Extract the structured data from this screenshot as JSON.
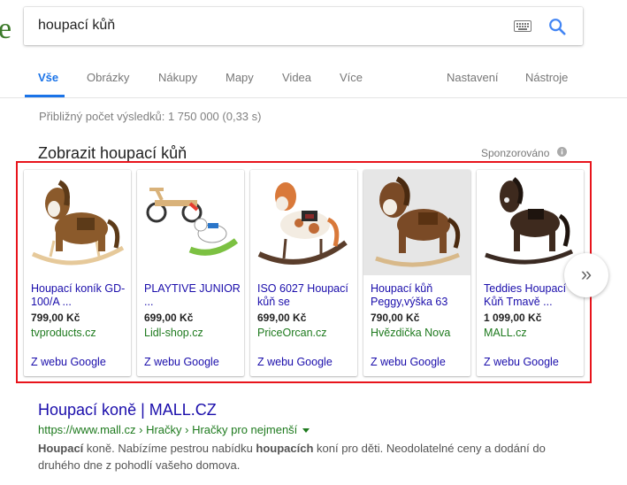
{
  "search": {
    "query": "houpací kůň"
  },
  "tabs": [
    {
      "label": "Vše",
      "active": true
    },
    {
      "label": "Obrázky"
    },
    {
      "label": "Nákupy"
    },
    {
      "label": "Mapy"
    },
    {
      "label": "Videa"
    },
    {
      "label": "Více"
    },
    {
      "label": "Nastavení"
    },
    {
      "label": "Nástroje"
    }
  ],
  "stats": "Přibližný počet výsledků: 1 750 000 (0,33 s)",
  "shopping": {
    "title": "Zobrazit houpací kůň",
    "sponsored": "Sponzorováno",
    "cards": [
      {
        "title": "Houpací koník GD-100/A ...",
        "price": "799,00 Kč",
        "store": "tvproducts.cz",
        "link": "Z webu Google"
      },
      {
        "title": "PLAYTIVE JUNIOR ...",
        "price": "699,00 Kč",
        "store": "Lidl-shop.cz",
        "link": "Z webu Google"
      },
      {
        "title": "ISO 6027 Houpací kůň se",
        "price": "699,00 Kč",
        "store": "PriceOrcan.cz",
        "link": "Z webu Google"
      },
      {
        "title": "Houpací kůň Peggy,výška 63",
        "price": "790,00 Kč",
        "store": "Hvězdička Nova",
        "link": "Z webu Google"
      },
      {
        "title": "Teddies Houpací Kůň Tmavě ...",
        "price": "1 099,00 Kč",
        "store": "MALL.cz",
        "link": "Z webu Google"
      }
    ]
  },
  "result": {
    "title": "Houpací koně | MALL.CZ",
    "url": "https://www.mall.cz › Hračky › Hračky pro nejmenší",
    "snippet_b1": "Houpací",
    "snippet_t1": " koně. Nabízíme pestrou nabídku ",
    "snippet_b2": "houpacích",
    "snippet_t2": " koní pro děti. Neodolatelné ceny a dodání do druhého dne z pohodlí vašeho domova."
  },
  "colors": {
    "accent": "#1a73e8",
    "link": "#1a0dab",
    "url": "#1e7a1e",
    "highlight": "#e8141c"
  }
}
